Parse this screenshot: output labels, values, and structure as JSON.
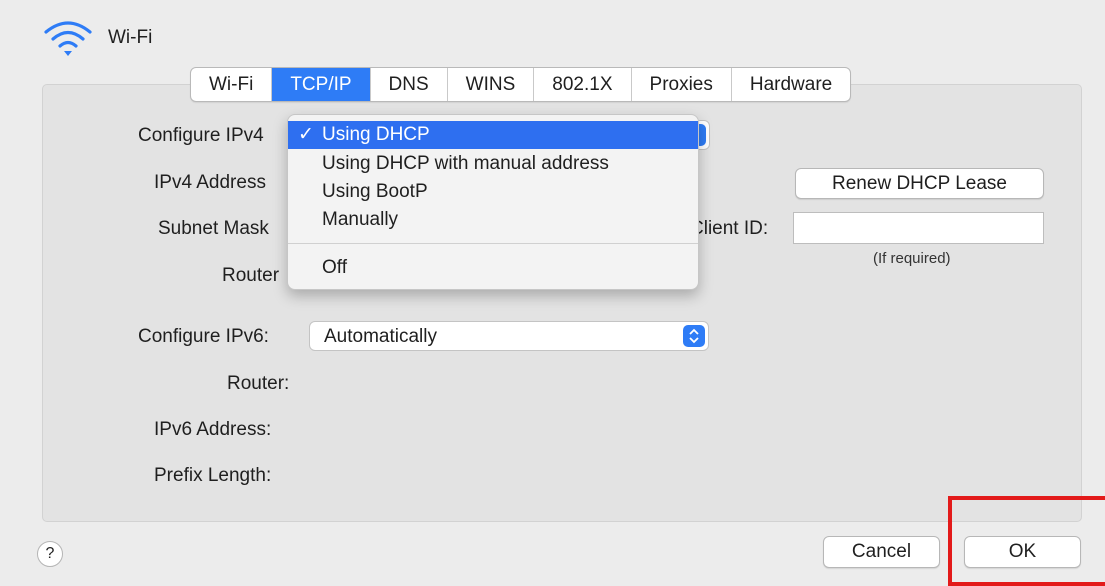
{
  "window": {
    "title": "Wi-Fi"
  },
  "tabs": [
    {
      "label": "Wi-Fi"
    },
    {
      "label": "TCP/IP"
    },
    {
      "label": "DNS"
    },
    {
      "label": "WINS"
    },
    {
      "label": "802.1X"
    },
    {
      "label": "Proxies"
    },
    {
      "label": "Hardware"
    }
  ],
  "active_tab": "TCP/IP",
  "ipv4": {
    "configure_label": "Configure IPv4",
    "address_label": "IPv4 Address",
    "subnet_label": "Subnet Mask",
    "router_label": "Router",
    "renew_button": "Renew DHCP Lease",
    "client_id_label": "Client ID:",
    "client_id_value": "",
    "client_id_hint": "(If required)"
  },
  "ipv4_menu": {
    "check_glyph": "✓",
    "items": [
      {
        "label": "Using DHCP",
        "selected": true
      },
      {
        "label": "Using DHCP with manual address",
        "selected": false
      },
      {
        "label": "Using BootP",
        "selected": false
      },
      {
        "label": "Manually",
        "selected": false
      },
      {
        "label": "Off",
        "selected": false
      }
    ]
  },
  "ipv6": {
    "configure_label": "Configure IPv6:",
    "configure_value": "Automatically",
    "router_label": "Router:",
    "address_label": "IPv6 Address:",
    "prefix_label": "Prefix Length:"
  },
  "footer": {
    "help_label": "?",
    "cancel_label": "Cancel",
    "ok_label": "OK"
  },
  "colors": {
    "accent": "#2e7cf6",
    "annotation": "#e31a1a"
  },
  "icons": {
    "wifi": "wifi-icon",
    "select_arrows": "chevron-up-down-icon",
    "check": "checkmark-icon"
  }
}
